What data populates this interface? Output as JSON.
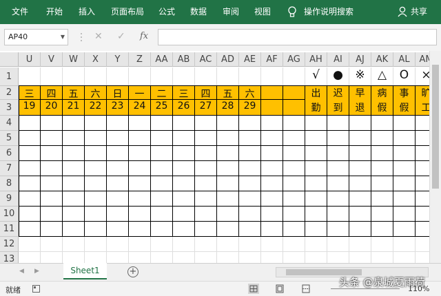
{
  "ribbon": {
    "tabs": [
      "文件",
      "开始",
      "插入",
      "页面布局",
      "公式",
      "数据",
      "审阅",
      "视图"
    ],
    "tell_me": "操作说明搜索",
    "share": "共享"
  },
  "formula_bar": {
    "name_box": "AP40",
    "fx_label": "fx",
    "cancel_glyph": "✕",
    "enter_glyph": "✓",
    "value": ""
  },
  "columns": [
    "U",
    "V",
    "W",
    "X",
    "Y",
    "Z",
    "AA",
    "AB",
    "AC",
    "AD",
    "AE",
    "AF",
    "AG",
    "AH",
    "AI",
    "AJ",
    "AK",
    "AL",
    "AM"
  ],
  "rows": [
    "1",
    "2",
    "3",
    "4",
    "5",
    "6",
    "7",
    "8",
    "9",
    "10",
    "11",
    "12",
    "13"
  ],
  "legend_symbols": [
    "√",
    "●",
    "※",
    "△",
    "O",
    "×"
  ],
  "weekdays": [
    "三",
    "四",
    "五",
    "六",
    "日",
    "一",
    "二",
    "三",
    "四",
    "五",
    "六"
  ],
  "dates": [
    "19",
    "20",
    "21",
    "22",
    "23",
    "24",
    "25",
    "26",
    "27",
    "28",
    "29"
  ],
  "status_labels": [
    "出勤",
    "迟到",
    "早退",
    "病假",
    "事假",
    "旷工"
  ],
  "sheet_tabs": [
    "Sheet1"
  ],
  "add_sheet": "+",
  "status_bar": {
    "ready": "就绪",
    "zoom": "110%"
  },
  "watermark": "头条 @泉城夏雨荷",
  "colors": {
    "accent": "#217346",
    "header_fill": "#ffc000"
  }
}
